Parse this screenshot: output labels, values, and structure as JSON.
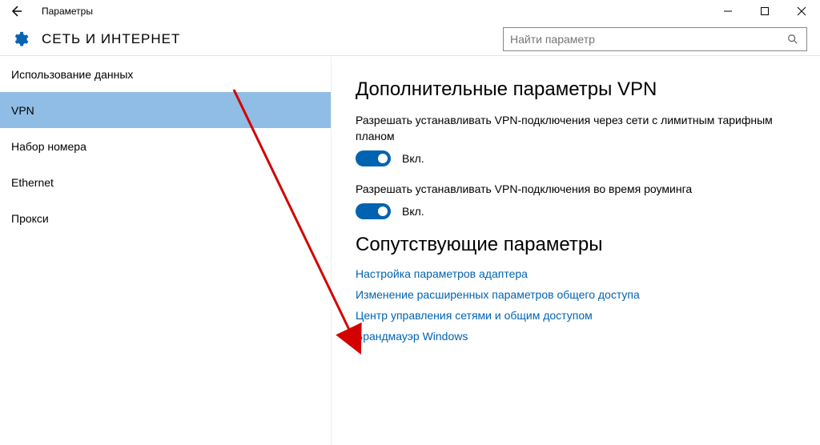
{
  "titlebar": {
    "title": "Параметры"
  },
  "header": {
    "caption": "СЕТЬ И ИНТЕРНЕТ",
    "search_placeholder": "Найти параметр"
  },
  "sidebar": {
    "items": [
      {
        "label": "Использование данных",
        "selected": false
      },
      {
        "label": "VPN",
        "selected": true
      },
      {
        "label": "Набор номера",
        "selected": false
      },
      {
        "label": "Ethernet",
        "selected": false
      },
      {
        "label": "Прокси",
        "selected": false
      }
    ]
  },
  "content": {
    "section1_title": "Дополнительные параметры VPN",
    "setting1_label": "Разрешать устанавливать VPN-подключения через сети с лимитным тарифным планом",
    "setting2_label": "Разрешать устанавливать VPN-подключения во время роуминга",
    "toggle_on_text": "Вкл.",
    "section2_title": "Сопутствующие параметры",
    "links": [
      "Настройка параметров адаптера",
      "Изменение расширенных параметров общего доступа",
      "Центр управления сетями и общим доступом",
      "Брандмауэр Windows"
    ]
  }
}
